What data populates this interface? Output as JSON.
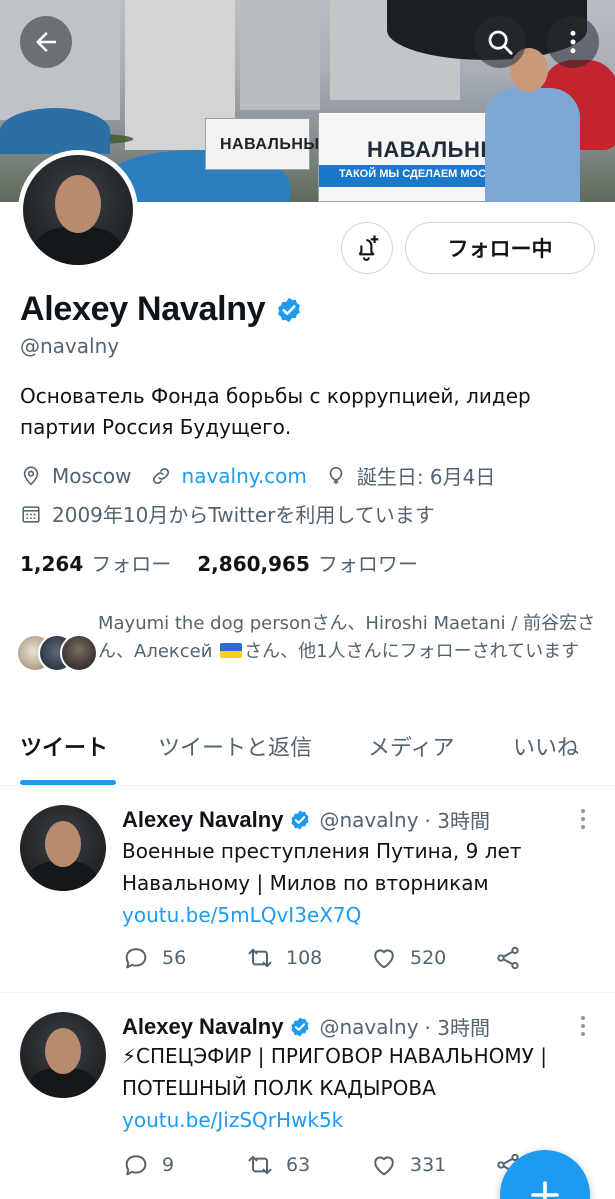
{
  "header": {
    "back_icon": "arrow-left-icon",
    "search_icon": "search-icon",
    "more_icon": "more-vertical-icon",
    "banner_sign_left": "НАВАЛЬНЫЙ",
    "banner_sign_right": "НАВАЛЬНЫ",
    "banner_sign_strip": "ТАКОЙ МЫ СДЕЛАЕМ МОСК"
  },
  "profile": {
    "name": "Alexey Navalny",
    "handle": "@navalny",
    "verified": true,
    "follow_button_label": "フォロー中",
    "bio": "Основатель Фонда борьбы с коррупцией, лидер партии Россия Будущего.",
    "location": "Moscow",
    "website": "navalny.com",
    "birthday": "誕生日: 6月4日",
    "joined": "2009年10月からTwitterを利用しています",
    "following_count": "1,264",
    "following_label": "フォロー",
    "followers_count": "2,860,965",
    "followers_label": "フォロワー",
    "followed_by_part1": "Mayumi the dog personさん、Hiroshi Maetani / 前谷宏さん、Алексей ",
    "followed_by_part2": "さん、他1人さんにフォローされています"
  },
  "tabs": [
    {
      "label": "ツイート",
      "active": true
    },
    {
      "label": "ツイートと返信",
      "active": false
    },
    {
      "label": "メディア",
      "active": false
    },
    {
      "label": "いいね",
      "active": false
    }
  ],
  "tweets": [
    {
      "name": "Alexey Navalny",
      "handle": "@navalny",
      "time": "· 3時間",
      "text": "Военные преступления Путина, 9 лет Навальному | Милов по вторникам",
      "link": "youtu.be/5mLQvI3eX7Q",
      "replies": "56",
      "retweets": "108",
      "likes": "520"
    },
    {
      "name": "Alexey Navalny",
      "handle": "@navalny",
      "time": "· 3時間",
      "text": "⚡СПЕЦЭФИР | ПРИГОВОР НАВАЛЬНОМУ | ПОТЕШНЫЙ ПОЛК КАДЫРОВА ",
      "link": "youtu.be/JizSQrHwk5k",
      "replies": "9",
      "retweets": "63",
      "likes": "331"
    }
  ],
  "fab": {
    "icon": "plus-icon"
  },
  "colors": {
    "accent": "#1d9bf0",
    "text": "#0f1419",
    "muted": "#536471",
    "border": "#cfd9de"
  }
}
